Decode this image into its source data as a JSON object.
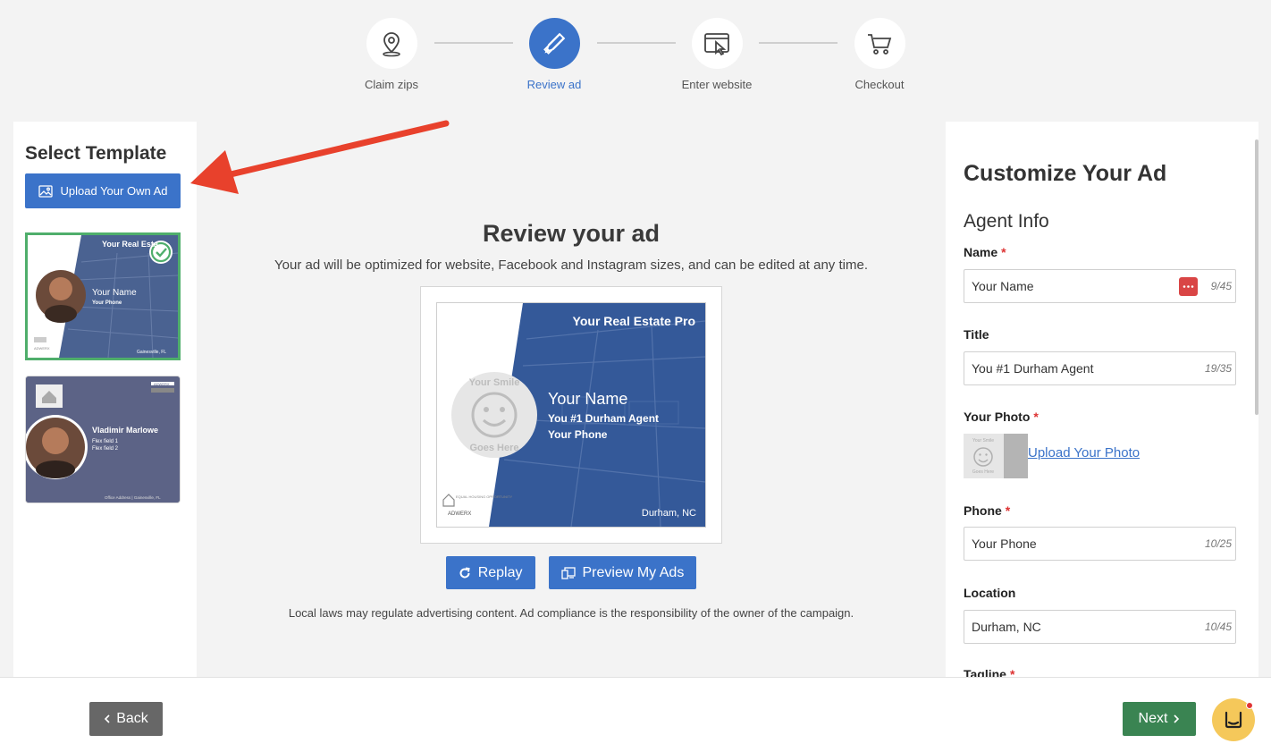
{
  "stepper": {
    "steps": [
      {
        "label": "Claim zips",
        "icon": "map-pin-icon"
      },
      {
        "label": "Review ad",
        "icon": "pencil-ruler-icon",
        "active": true
      },
      {
        "label": "Enter website",
        "icon": "browser-cursor-icon"
      },
      {
        "label": "Checkout",
        "icon": "shopping-cart-icon"
      }
    ]
  },
  "left": {
    "title": "Select Template",
    "upload_own_label": "Upload Your Own Ad",
    "template1": {
      "header": "Your Real Esta",
      "name": "Your Name",
      "phone": "Your Phone",
      "location": "Gainesville, FL",
      "selected": true
    },
    "template2": {
      "brand": "ADWERX",
      "name": "Vladimir Marlowe",
      "flex1": "Flex field 1",
      "flex2": "Flex field 2",
      "footer": "Office Address | Gainesville, FL"
    }
  },
  "center": {
    "title": "Review your ad",
    "subtitle": "Your ad will be optimized for website, Facebook and Instagram sizes, and can be edited at any time.",
    "ad": {
      "header": "Your Real Estate Pro",
      "smile_top": "Your Smile",
      "smile_bottom": "Goes Here",
      "name": "Your Name",
      "title": "You #1 Durham Agent",
      "phone": "Your Phone",
      "location": "Durham, NC",
      "eho_text": "EQUAL HOUSING OPPORTUNITY",
      "brand": "ADWERX"
    },
    "replay_label": "Replay",
    "preview_label": "Preview My Ads",
    "disclaimer": "Local laws may regulate advertising content. Ad compliance is the responsibility of the owner of the campaign."
  },
  "right": {
    "title": "Customize Your Ad",
    "section": "Agent Info",
    "name_label": "Name",
    "name_value": "Your Name",
    "name_counter": "9/45",
    "title_label": "Title",
    "title_value": "You #1 Durham Agent",
    "title_counter": "19/35",
    "photo_label": "Your Photo",
    "photo_thumb_top": "Your Smile",
    "photo_thumb_bottom": "Goes Here",
    "photo_link": "Upload Your Photo",
    "phone_label": "Phone",
    "phone_value": "Your Phone",
    "phone_counter": "10/25",
    "location_label": "Location",
    "location_value": "Durham, NC",
    "location_counter": "10/45",
    "tagline_label": "Tagline",
    "required_mark": "*"
  },
  "bottom": {
    "back_label": "Back",
    "next_label": "Next"
  },
  "colors": {
    "primary": "#3b73c9",
    "success": "#3a8452",
    "selected_border": "#4fae6b",
    "annotation_arrow": "#e8412c"
  }
}
